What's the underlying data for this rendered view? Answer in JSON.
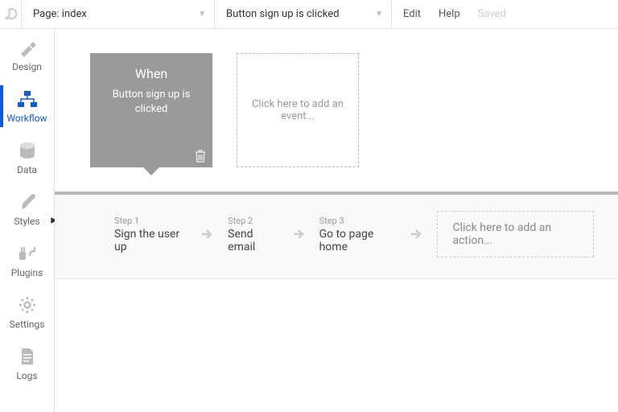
{
  "topbar": {
    "page_dropdown_label": "Page: index",
    "event_dropdown_label": "Button sign up is clicked",
    "edit": "Edit",
    "help": "Help",
    "saved": "Saved"
  },
  "sidebar": {
    "items": [
      {
        "label": "Design"
      },
      {
        "label": "Workflow"
      },
      {
        "label": "Data"
      },
      {
        "label": "Styles"
      },
      {
        "label": "Plugins"
      },
      {
        "label": "Settings"
      },
      {
        "label": "Logs"
      }
    ]
  },
  "events": {
    "selected": {
      "when": "When",
      "desc": "Button sign up is clicked"
    },
    "add_placeholder": "Click here to add an event..."
  },
  "steps": [
    {
      "label": "Step 1",
      "title": "Sign the user up"
    },
    {
      "label": "Step 2",
      "title": "Send email"
    },
    {
      "label": "Step 3",
      "title": "Go to page home"
    }
  ],
  "add_action": "Click here to add an action..."
}
